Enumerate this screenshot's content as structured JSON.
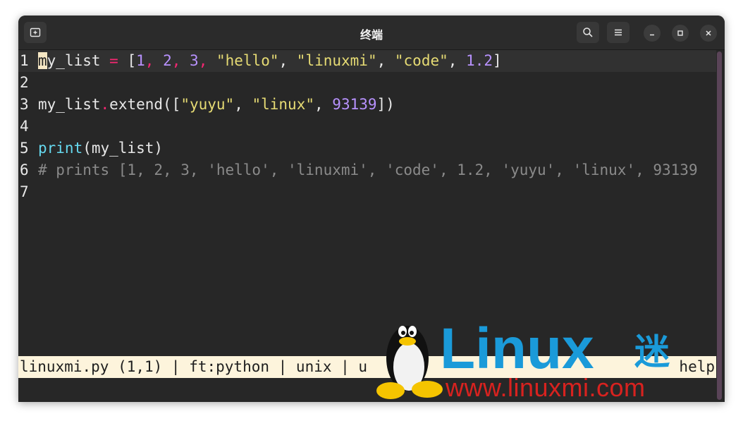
{
  "window": {
    "title": "终端"
  },
  "editor": {
    "lines": [
      {
        "n": "1"
      },
      {
        "n": "2"
      },
      {
        "n": "3"
      },
      {
        "n": "4"
      },
      {
        "n": "5"
      },
      {
        "n": "6"
      },
      {
        "n": "7"
      }
    ],
    "line1": {
      "cursor_char": "m",
      "t1": "y_list ",
      "eq": "=",
      "t2": " [",
      "n1": "1",
      "c1": ", ",
      "n2": "2",
      "c2": ", ",
      "n3": "3",
      "c3": ", ",
      "s1": "\"hello\"",
      "c4": ", ",
      "s2": "\"linuxmi\"",
      "c5": ", ",
      "s3": "\"code\"",
      "c6": ", ",
      "n4": "1.2",
      "end": "]"
    },
    "line3": {
      "t1": "my_list",
      "dot": ".",
      "t2": "extend([",
      "s1": "\"yuyu\"",
      "c1": ", ",
      "s2": "\"linux\"",
      "c2": ", ",
      "n1": "93139",
      "end": "])"
    },
    "line5": {
      "fn": "print",
      "args": "(my_list)"
    },
    "line6": {
      "comment": "# prints [1, 2, 3, 'hello', 'linuxmi', 'code', 1.2, 'yuyu', 'linux', 93139"
    }
  },
  "statusline": {
    "left": "linuxmi.py (1,1) | ft:python | unix | u",
    "right": "help"
  },
  "watermark": {
    "brand": "Linux",
    "brand_suffix": "迷",
    "url": "www.linuxmi.com"
  },
  "colors": {
    "terminal_bg": "#272727",
    "statusline_bg": "#fdf4dc",
    "accent_blue": "#1a9ad9",
    "accent_red": "#d8221f"
  }
}
